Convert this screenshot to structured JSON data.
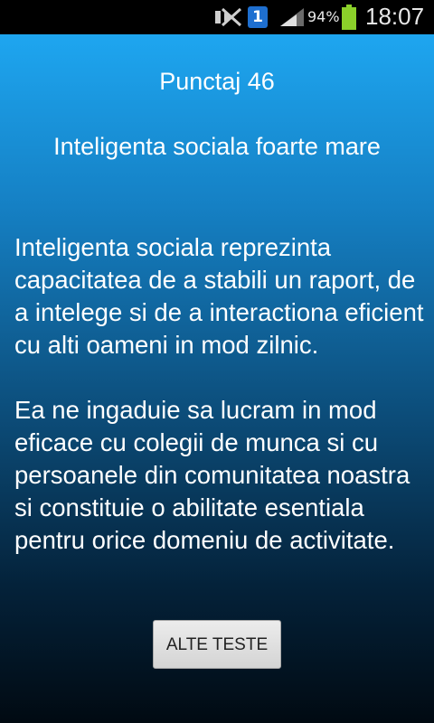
{
  "status_bar": {
    "sim_slot": "1",
    "battery_percent": "94%",
    "time": "18:07",
    "icons": [
      "notification-sync-icon",
      "sim-slot-icon",
      "signal-icon",
      "battery-icon"
    ]
  },
  "result": {
    "score_label": "Punctaj 46",
    "title": "Inteligenta sociala foarte mare",
    "paragraphs": [
      "Inteligenta sociala reprezinta capacitatea de a stabili un raport, de a intelege si de a interactiona eficient cu alti oameni in mod zilnic.",
      "Ea ne ingaduie sa lucram in mod eficace cu colegii de munca si cu persoanele din comunitatea noastra si constituie o abilitate esentiala pentru orice domeniu de activitate."
    ]
  },
  "actions": {
    "more_tests_label": "ALTE TESTE"
  },
  "colors": {
    "gradient_top": "#1ea6f0",
    "gradient_bottom": "#010a12",
    "battery_green": "#8bd12a",
    "sim_blue": "#1e6fd0"
  }
}
